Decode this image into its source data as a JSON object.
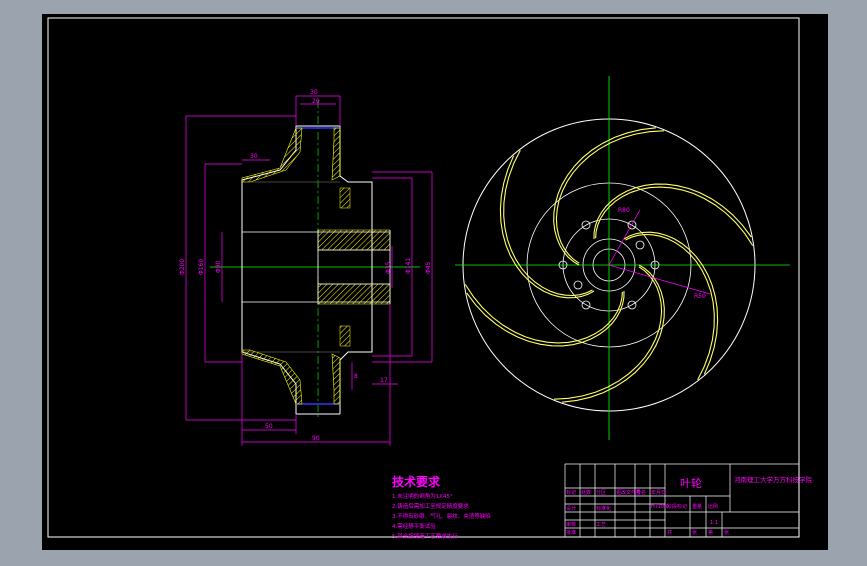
{
  "palette": {
    "frame_bg": "#aab3bd",
    "sheet": "#000000",
    "border": "#ffffff",
    "dims": "#ff00ff",
    "centerline": "#00ff00",
    "blades": "#ffff66",
    "hatch": "#ffff00",
    "blue": "#0000ff"
  },
  "technical_requirements": {
    "title": "技术要求",
    "items": [
      "1.未注明的倒角为1X45°",
      "2.铸造后需加工至规定精度要求",
      "3.不得有砂眼、气孔、裂纹、夹渣等缺陷",
      "4.需经静平衡试验",
      "5.其余按铸造工艺要求执行"
    ]
  },
  "title_block": {
    "part_name": "叶轮",
    "school": "河南理工大学万方科技学院",
    "material": "HT18.0",
    "scale": "1:1",
    "cells": [
      "标记",
      "处数",
      "分区",
      "更改文件号",
      "签名",
      "年月日",
      "设计",
      "标准化",
      "阶段标记",
      "重量",
      "比例",
      "审核",
      "工艺",
      "批准",
      "共",
      "张",
      "第",
      "张"
    ]
  },
  "dimensions": {
    "top_30": "30",
    "top_20": "20",
    "hub_30": "30",
    "bottom_50": "50",
    "bottom_90": "90",
    "right_17": "17",
    "right_8": "8",
    "dia_outer": "Φ200",
    "dia_shroud": "Φ160",
    "dia_inlet": "Φ90",
    "dia_hub": "Φ35",
    "dia_r1": "Φ141",
    "dia_r2": "Φ45",
    "dia_bore": "Φ25",
    "radial_1": "R50",
    "radial_2": "R80"
  }
}
